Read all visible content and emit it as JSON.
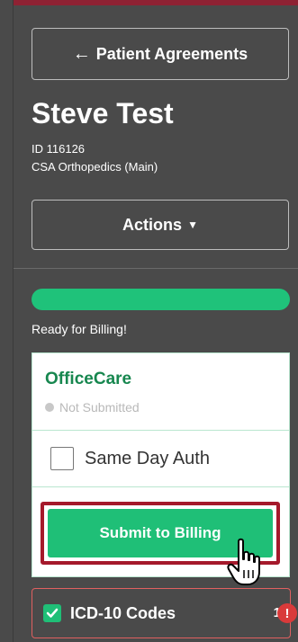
{
  "back_button": {
    "label": "Patient Agreements",
    "icon": "arrow-left-icon"
  },
  "patient": {
    "name": "Steve Test",
    "id_text": "ID 116126",
    "clinic": "CSA Orthopedics (Main)"
  },
  "actions": {
    "label": "Actions",
    "icon": "caret-down-icon"
  },
  "progress": {
    "percent": 100,
    "color": "#1fc27a"
  },
  "status_text": "Ready for Billing!",
  "card": {
    "title": "OfficeCare",
    "status": "Not Submitted",
    "same_day_auth_label": "Same Day Auth",
    "same_day_auth_checked": false,
    "submit_label": "Submit to Billing"
  },
  "icd": {
    "label": "ICD-10 Codes",
    "checked": true,
    "count": "1",
    "alert_icon": "exclamation-icon"
  },
  "colors": {
    "accent_green": "#1fbf77",
    "title_green": "#17874f",
    "highlight_red": "#a5192b",
    "top_stripe": "#8e2233"
  }
}
